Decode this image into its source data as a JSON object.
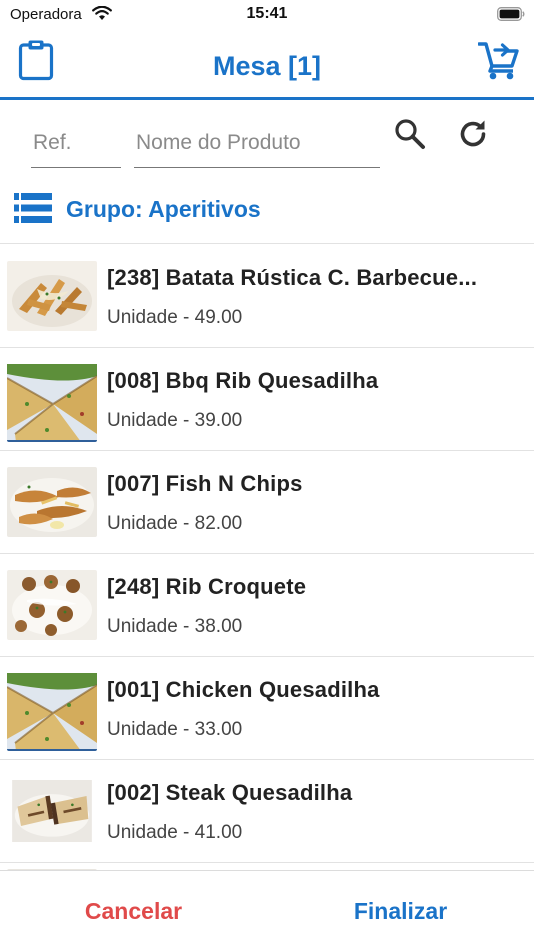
{
  "status_bar": {
    "carrier": "Operadora",
    "time": "15:41",
    "wifi_icon": "wifi-icon",
    "battery_icon": "battery-icon"
  },
  "header": {
    "title": "Mesa [1]",
    "left_icon": "clipboard-icon",
    "right_icon": "cart-add-icon",
    "accent_color": "#1a73c8"
  },
  "search": {
    "ref_placeholder": "Ref.",
    "ref_value": "",
    "name_placeholder": "Nome do Produto",
    "name_value": "",
    "search_icon": "search-icon",
    "refresh_icon": "refresh-icon"
  },
  "group": {
    "label": "Grupo: Aperitivos",
    "icon": "list-icon"
  },
  "products": [
    {
      "name": "[238] Batata Rústica C. Barbecue...",
      "price": "Unidade - 49.00",
      "image": "potato-wedges-image"
    },
    {
      "name": "[008] Bbq Rib Quesadilha",
      "price": "Unidade - 39.00",
      "image": "quesadilla-image"
    },
    {
      "name": "[007] Fish N Chips",
      "price": "Unidade - 82.00",
      "image": "fried-fish-image"
    },
    {
      "name": "[248] Rib Croquete",
      "price": "Unidade - 38.00",
      "image": "croquette-image"
    },
    {
      "name": "[001] Chicken Quesadilha",
      "price": "Unidade - 33.00",
      "image": "quesadilla-image"
    },
    {
      "name": "[002] Steak Quesadilha",
      "price": "Unidade - 41.00",
      "image": "steak-quesadilla-image"
    }
  ],
  "footer": {
    "cancel_label": "Cancelar",
    "finish_label": "Finalizar",
    "cancel_color": "#e04a4a",
    "finish_color": "#1a73c8"
  }
}
